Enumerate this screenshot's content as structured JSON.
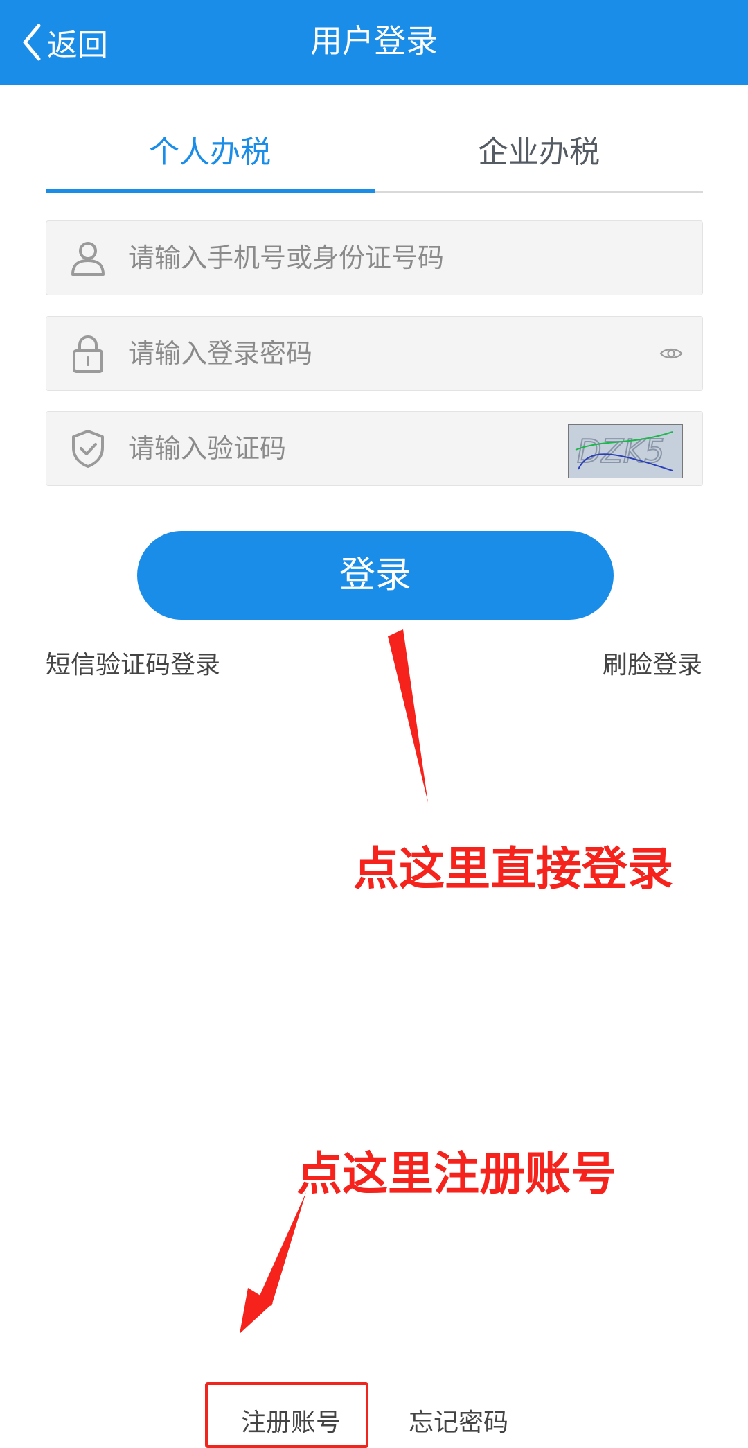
{
  "navbar": {
    "back_label": "返回",
    "title": "用户登录"
  },
  "tabs": [
    {
      "label": "个人办税",
      "active": true
    },
    {
      "label": "企业办税",
      "active": false
    }
  ],
  "form": {
    "account_placeholder": "请输入手机号或身份证号码",
    "password_placeholder": "请输入登录密码",
    "captcha_placeholder": "请输入验证码",
    "captcha_text": "DZK5"
  },
  "login_label": "登录",
  "links": {
    "sms_login": "短信验证码登录",
    "face_login": "刷脸登录",
    "register": "注册账号",
    "forgot": "忘记密码"
  },
  "annotations": {
    "login_hint": "点这里直接登录",
    "register_hint": "点这里注册账号"
  },
  "colors": {
    "primary": "#1a8de8",
    "annotation": "#f5231c"
  }
}
